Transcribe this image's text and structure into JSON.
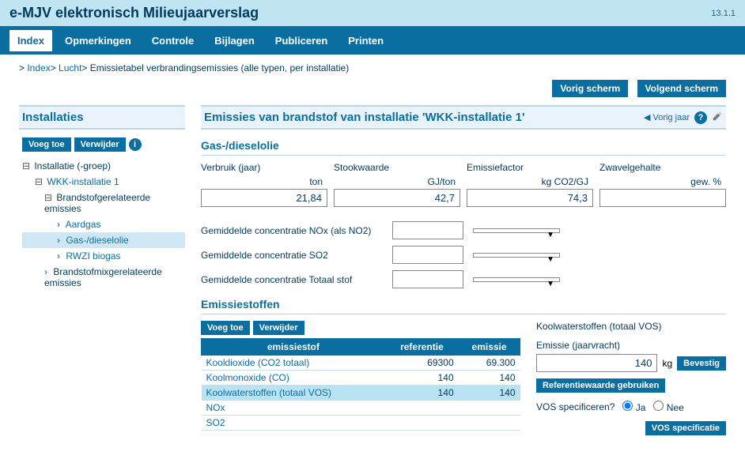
{
  "app": {
    "title": "e-MJV elektronisch Milieujaarverslag",
    "version": "13.1.1"
  },
  "nav": {
    "items": [
      {
        "label": "Index",
        "active": true
      },
      {
        "label": "Opmerkingen"
      },
      {
        "label": "Controle"
      },
      {
        "label": "Bijlagen"
      },
      {
        "label": "Publiceren"
      },
      {
        "label": "Printen"
      }
    ]
  },
  "breadcrumb": {
    "prefix": ">",
    "parts": [
      "Index",
      "Lucht",
      "Emissietabel verbrandingsemissies (alle typen, per installatie)"
    ]
  },
  "navButtons": {
    "prev": "Vorig scherm",
    "next": "Volgend scherm"
  },
  "sidebar": {
    "title": "Installaties",
    "add": "Voeg toe",
    "remove": "Verwijder",
    "tree": {
      "root": "Installatie (-groep)",
      "inst": "WKK-installatie 1",
      "bgroup": "Brandstofgerelateerde emissies",
      "fuels": [
        "Aardgas",
        "Gas-/dieselolie",
        "RWZI biogas"
      ],
      "mix": "Brandstofmixgerelateerde emissies"
    }
  },
  "main": {
    "title": "Emissies van brandstof van installatie 'WKK-installatie 1'",
    "prevYear": "Vorig jaar"
  },
  "gas": {
    "section": "Gas-/dieselolie",
    "cols": {
      "verbruik": {
        "label": "Verbruik (jaar)",
        "unit": "ton",
        "value": "21,84"
      },
      "stook": {
        "label": "Stookwaarde",
        "unit": "GJ/ton",
        "value": "42,7"
      },
      "ef": {
        "label": "Emissiefactor",
        "unit": "kg CO2/GJ",
        "value": "74,3"
      },
      "zwavel": {
        "label": "Zwavelgehalte",
        "unit": "gew. %",
        "value": ""
      }
    },
    "conc": {
      "nox": "Gemiddelde concentratie NOx (als NO2)",
      "so2": "Gemiddelde concentratie SO2",
      "stof": "Gemiddelde concentratie Totaal stof"
    }
  },
  "em": {
    "section": "Emissiestoffen",
    "add": "Voeg toe",
    "remove": "Verwijder",
    "headers": [
      "emissiestof",
      "referentie",
      "emissie"
    ],
    "rows": [
      {
        "stof": "Kooldioxide (CO2 totaal)",
        "ref": "69300",
        "emi": "69.300"
      },
      {
        "stof": "Koolmonoxide (CO)",
        "ref": "140",
        "emi": "140"
      },
      {
        "stof": "Koolwaterstoffen (totaal VOS)",
        "ref": "140",
        "emi": "140",
        "selected": true
      },
      {
        "stof": "NOx",
        "ref": "",
        "emi": ""
      },
      {
        "stof": "SO2",
        "ref": "",
        "emi": ""
      }
    ]
  },
  "right": {
    "title": "Koolwaterstoffen (totaal VOS)",
    "emLabel": "Emissie (jaarvracht)",
    "value": "140",
    "unit": "kg",
    "confirm": "Bevestig",
    "refBtn": "Referentiewaarde gebruiken",
    "vosSpec": "VOS specificeren?",
    "ja": "Ja",
    "nee": "Nee",
    "vosBtn": "VOS specificatie"
  }
}
